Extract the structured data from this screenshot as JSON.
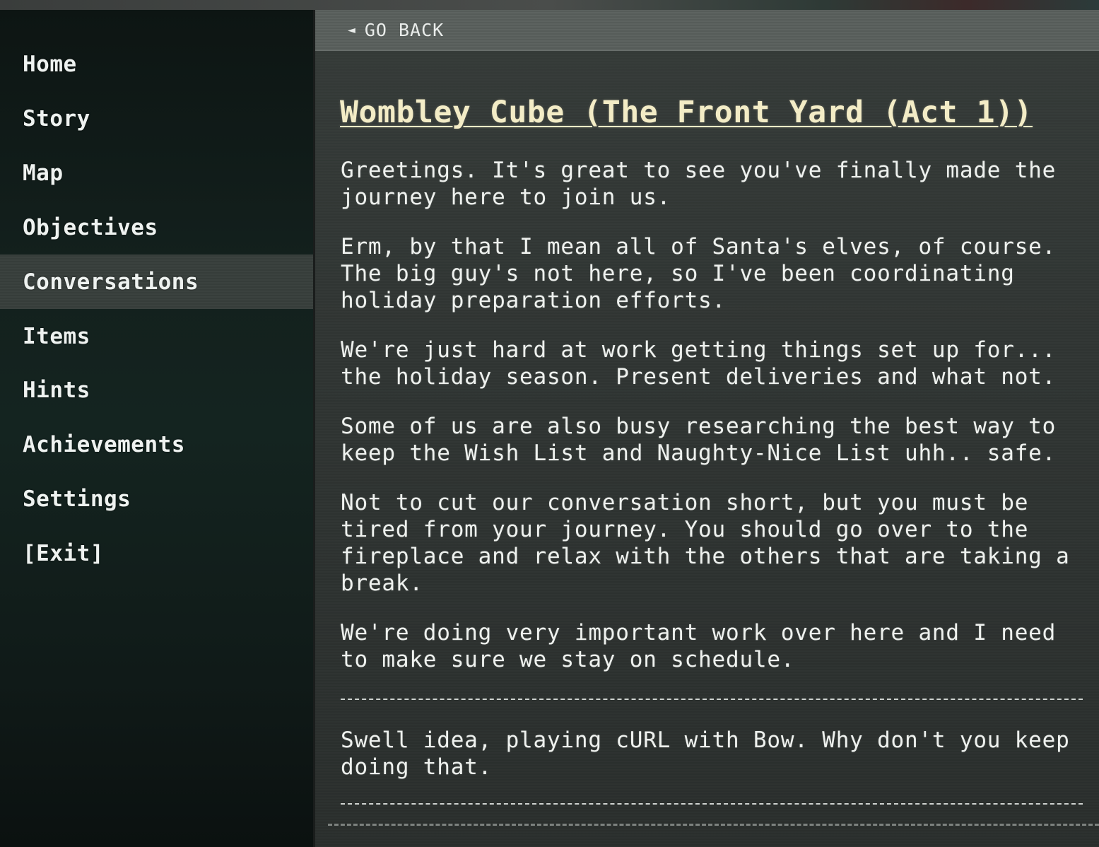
{
  "sidebar": {
    "items": [
      {
        "label": "Home"
      },
      {
        "label": "Story"
      },
      {
        "label": "Map"
      },
      {
        "label": "Objectives"
      },
      {
        "label": "Conversations",
        "active": true
      },
      {
        "label": "Items"
      },
      {
        "label": "Hints"
      },
      {
        "label": "Achievements"
      },
      {
        "label": "Settings"
      },
      {
        "label": "[Exit]"
      }
    ]
  },
  "header": {
    "back_icon": "◄",
    "back_label": "GO BACK"
  },
  "conversation": {
    "title": "Wombley Cube (The Front Yard (Act 1))",
    "paragraphs": [
      "Greetings. It's great to see you've finally made the journey here to join us.",
      "Erm, by that I mean all of Santa's elves, of course. The big guy's not here, so I've been coordinating holiday preparation efforts.",
      "We're just hard at work getting things set up for... the holiday season. Present deliveries and what not.",
      "Some of us are also busy researching the best way to keep the Wish List and Naughty-Nice List uhh.. safe.",
      "Not to cut our conversation short, but you must be tired from your journey. You should go over to the fireplace and relax with the others that are taking a break.",
      "We're doing very important work over here and I need to make sure we stay on schedule."
    ],
    "followup": "Swell idea, playing cURL with Bow. Why don't you keep doing that."
  },
  "colors": {
    "title": "#f3ecc6",
    "text": "#eef1ee",
    "sidebar_bg": "#101a18",
    "active_item_bg": "#3b423f",
    "main_bg": "#323735"
  },
  "icons": {
    "back": "left-triangle-icon"
  }
}
